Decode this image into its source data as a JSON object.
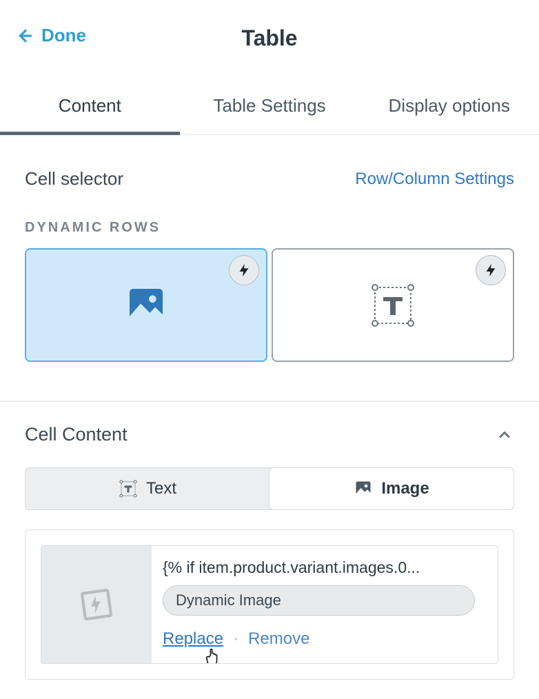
{
  "header": {
    "done_label": "Done",
    "title": "Table"
  },
  "tabs": [
    {
      "id": "content",
      "label": "Content",
      "active": true
    },
    {
      "id": "table-settings",
      "label": "Table Settings",
      "active": false
    },
    {
      "id": "display-options",
      "label": "Display options",
      "active": false
    }
  ],
  "cell_selector": {
    "label": "Cell selector",
    "settings_link": "Row/Column Settings"
  },
  "dynamic_rows": {
    "heading": "DYNAMIC ROWS",
    "cards": [
      {
        "type": "image",
        "selected": true
      },
      {
        "type": "text",
        "selected": false
      }
    ]
  },
  "cell_content": {
    "heading": "Cell Content",
    "expanded": true,
    "toggle": {
      "text_label": "Text",
      "image_label": "Image",
      "active": "image"
    },
    "image_item": {
      "code_snippet": "{% if item.product.variant.images.0...",
      "badge": "Dynamic Image",
      "replace_label": "Replace",
      "remove_label": "Remove"
    }
  }
}
